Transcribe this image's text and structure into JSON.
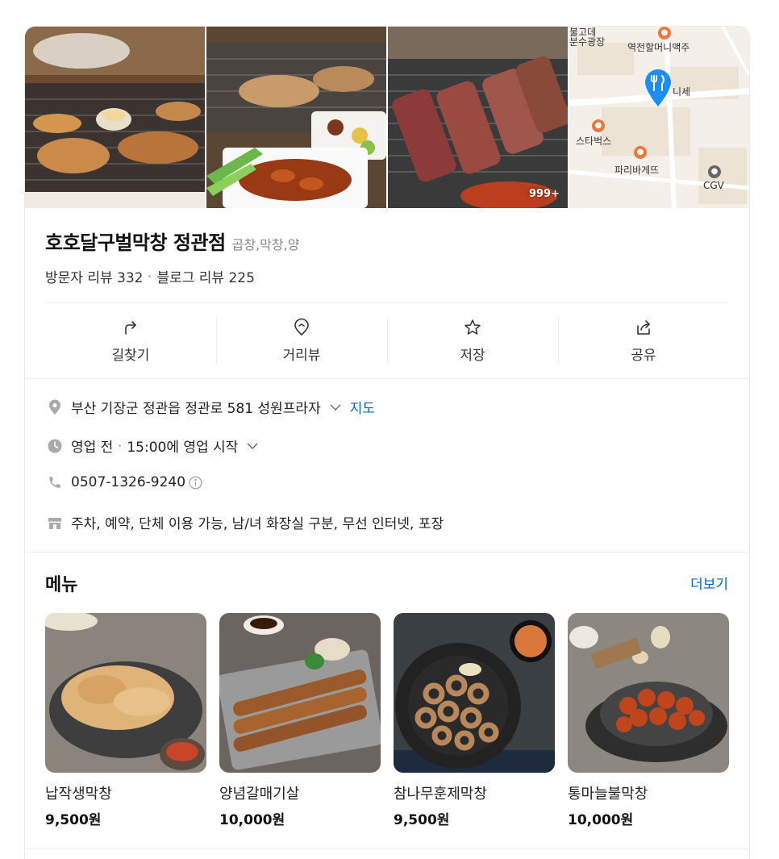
{
  "photos": {
    "count_badge": "999+"
  },
  "map": {
    "labels": [
      "불고데",
      "분수광장",
      "역전할머니맥주",
      "니세",
      "스타벅스",
      "파리바게뜨",
      "CGV"
    ]
  },
  "place": {
    "name": "호호달구벌막창 정관점",
    "category": "곱창,막창,양",
    "visitor_reviews": "방문자 리뷰 332",
    "blog_reviews": "블로그 리뷰 225"
  },
  "actions": [
    {
      "label": "길찾기",
      "icon": "directions-icon"
    },
    {
      "label": "거리뷰",
      "icon": "streetview-icon"
    },
    {
      "label": "저장",
      "icon": "star-icon"
    },
    {
      "label": "공유",
      "icon": "share-icon"
    }
  ],
  "details": {
    "address": "부산 기장군 정관읍 정관로 581 성원프라자",
    "map_link": "지도",
    "hours_status": "영업 전",
    "hours_next": "15:00에 영업 시작",
    "phone": "0507-1326-9240",
    "amenities": "주차, 예약, 단체 이용 가능, 남/녀 화장실 구분, 무선 인터넷, 포장"
  },
  "menu": {
    "title": "메뉴",
    "more": "더보기",
    "items": [
      {
        "name": "납작생막창",
        "price": "9,500원"
      },
      {
        "name": "양념갈매기살",
        "price": "10,000원"
      },
      {
        "name": "참나무훈제막창",
        "price": "9,500원"
      },
      {
        "name": "통마늘불막창",
        "price": "10,000원"
      }
    ]
  },
  "colors": {
    "link": "#0068c3",
    "pin": "#1a8ef5",
    "poi_orange": "#e8793a"
  }
}
